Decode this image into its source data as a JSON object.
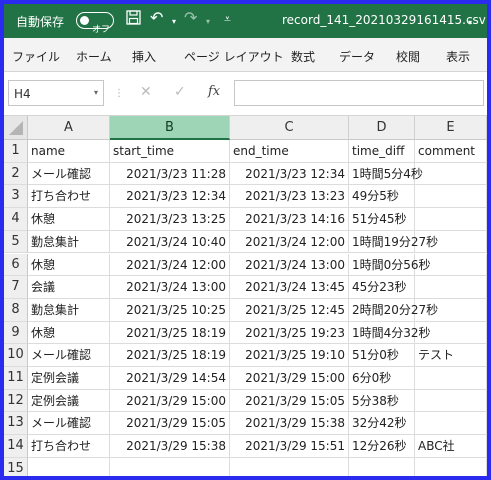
{
  "titlebar": {
    "autosave_label": "自動保存",
    "toggle_state": "オフ",
    "save_icon": "save-icon",
    "undo_icon": "undo-icon",
    "redo_icon": "redo-icon",
    "filename": "record_141_20210329161415.csv",
    "bg_color": "#217346"
  },
  "ribbon": {
    "tabs": [
      "ファイル",
      "ホーム",
      "挿入",
      "ページ レイアウト",
      "数式",
      "データ",
      "校閲",
      "表示"
    ]
  },
  "formula_bar": {
    "name_box": "H4",
    "fx_label": "fx",
    "formula_value": ""
  },
  "grid": {
    "columns": [
      "A",
      "B",
      "C",
      "D",
      "E"
    ],
    "selected_column": "B",
    "header_row": [
      "name",
      "start_time",
      "end_time",
      "time_diff",
      "comment"
    ],
    "rows": [
      {
        "n": "1",
        "cells": [
          "name",
          "start_time",
          "end_time",
          "time_diff",
          "comment"
        ]
      },
      {
        "n": "2",
        "cells": [
          "メール確認",
          "2021/3/23 11:28",
          "2021/3/23 12:34",
          "1時間5分4秒",
          ""
        ]
      },
      {
        "n": "3",
        "cells": [
          "打ち合わせ",
          "2021/3/23 12:34",
          "2021/3/23 13:23",
          "49分5秒",
          ""
        ]
      },
      {
        "n": "4",
        "cells": [
          "休憩",
          "2021/3/23 13:25",
          "2021/3/23 14:16",
          "51分45秒",
          ""
        ]
      },
      {
        "n": "5",
        "cells": [
          "勤怠集計",
          "2021/3/24 10:40",
          "2021/3/24 12:00",
          "1時間19分27秒",
          ""
        ]
      },
      {
        "n": "6",
        "cells": [
          "休憩",
          "2021/3/24 12:00",
          "2021/3/24 13:00",
          "1時間0分56秒",
          ""
        ]
      },
      {
        "n": "7",
        "cells": [
          "会議",
          "2021/3/24 13:00",
          "2021/3/24 13:45",
          "45分23秒",
          ""
        ]
      },
      {
        "n": "8",
        "cells": [
          "勤怠集計",
          "2021/3/25 10:25",
          "2021/3/25 12:45",
          "2時間20分27秒",
          ""
        ]
      },
      {
        "n": "9",
        "cells": [
          "休憩",
          "2021/3/25 18:19",
          "2021/3/25 19:23",
          "1時間4分32秒",
          ""
        ]
      },
      {
        "n": "10",
        "cells": [
          "メール確認",
          "2021/3/25 18:19",
          "2021/3/25 19:10",
          "51分0秒",
          "テスト"
        ]
      },
      {
        "n": "11",
        "cells": [
          "定例会議",
          "2021/3/29 14:54",
          "2021/3/29 15:00",
          "6分0秒",
          ""
        ]
      },
      {
        "n": "12",
        "cells": [
          "定例会議",
          "2021/3/29 15:00",
          "2021/3/29 15:05",
          "5分38秒",
          ""
        ]
      },
      {
        "n": "13",
        "cells": [
          "メール確認",
          "2021/3/29 15:05",
          "2021/3/29 15:38",
          "32分42秒",
          ""
        ]
      },
      {
        "n": "14",
        "cells": [
          "打ち合わせ",
          "2021/3/29 15:38",
          "2021/3/29 15:51",
          "12分26秒",
          "ABC社"
        ]
      },
      {
        "n": "15",
        "cells": [
          "",
          "",
          "",
          "",
          ""
        ]
      }
    ]
  }
}
